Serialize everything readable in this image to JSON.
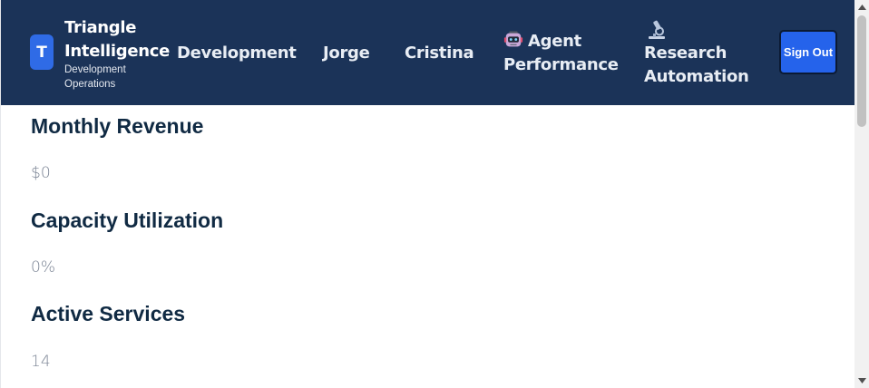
{
  "brand": {
    "logo_letter": "T",
    "name": "Triangle Intelligence",
    "subtitle": "Development Operations"
  },
  "nav": {
    "development": "Development",
    "jorge": "Jorge",
    "cristina": "Cristina",
    "agent_performance": "Agent Performance",
    "research_automation": "Research Automation",
    "agent_icon": "robot-icon",
    "research_icon": "microscope-icon"
  },
  "signout": {
    "label": "Sign Out"
  },
  "metrics": [
    {
      "title": "Monthly Revenue",
      "value": "$0"
    },
    {
      "title": "Capacity Utilization",
      "value": "0%"
    },
    {
      "title": "Active Services",
      "value": "14"
    }
  ],
  "colors": {
    "navbar": "#1b3358",
    "accent": "#2563eb",
    "heading": "#102a43",
    "value_text": "#7b8494"
  }
}
